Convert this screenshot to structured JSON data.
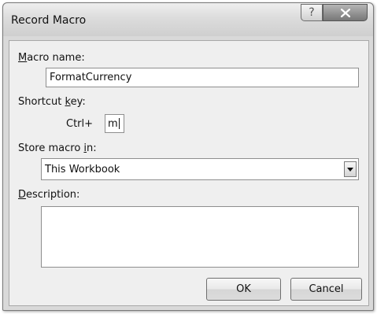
{
  "window": {
    "title": "Record Macro",
    "help_glyph": "?",
    "close_icon": "close-icon"
  },
  "macro_name": {
    "label_accel": "M",
    "label_rest": "acro name:",
    "value": "FormatCurrency"
  },
  "shortcut": {
    "label_pre": "Shortcut ",
    "label_accel": "k",
    "label_post": "ey:",
    "prefix": "Ctrl+",
    "value": "m"
  },
  "store": {
    "label_pre": "Store macro ",
    "label_accel": "i",
    "label_post": "n:",
    "selected": "This Workbook",
    "arrow_icon": "dropdown-arrow-icon"
  },
  "description": {
    "label_accel": "D",
    "label_rest": "escription:",
    "value": ""
  },
  "buttons": {
    "ok": "OK",
    "cancel": "Cancel"
  }
}
